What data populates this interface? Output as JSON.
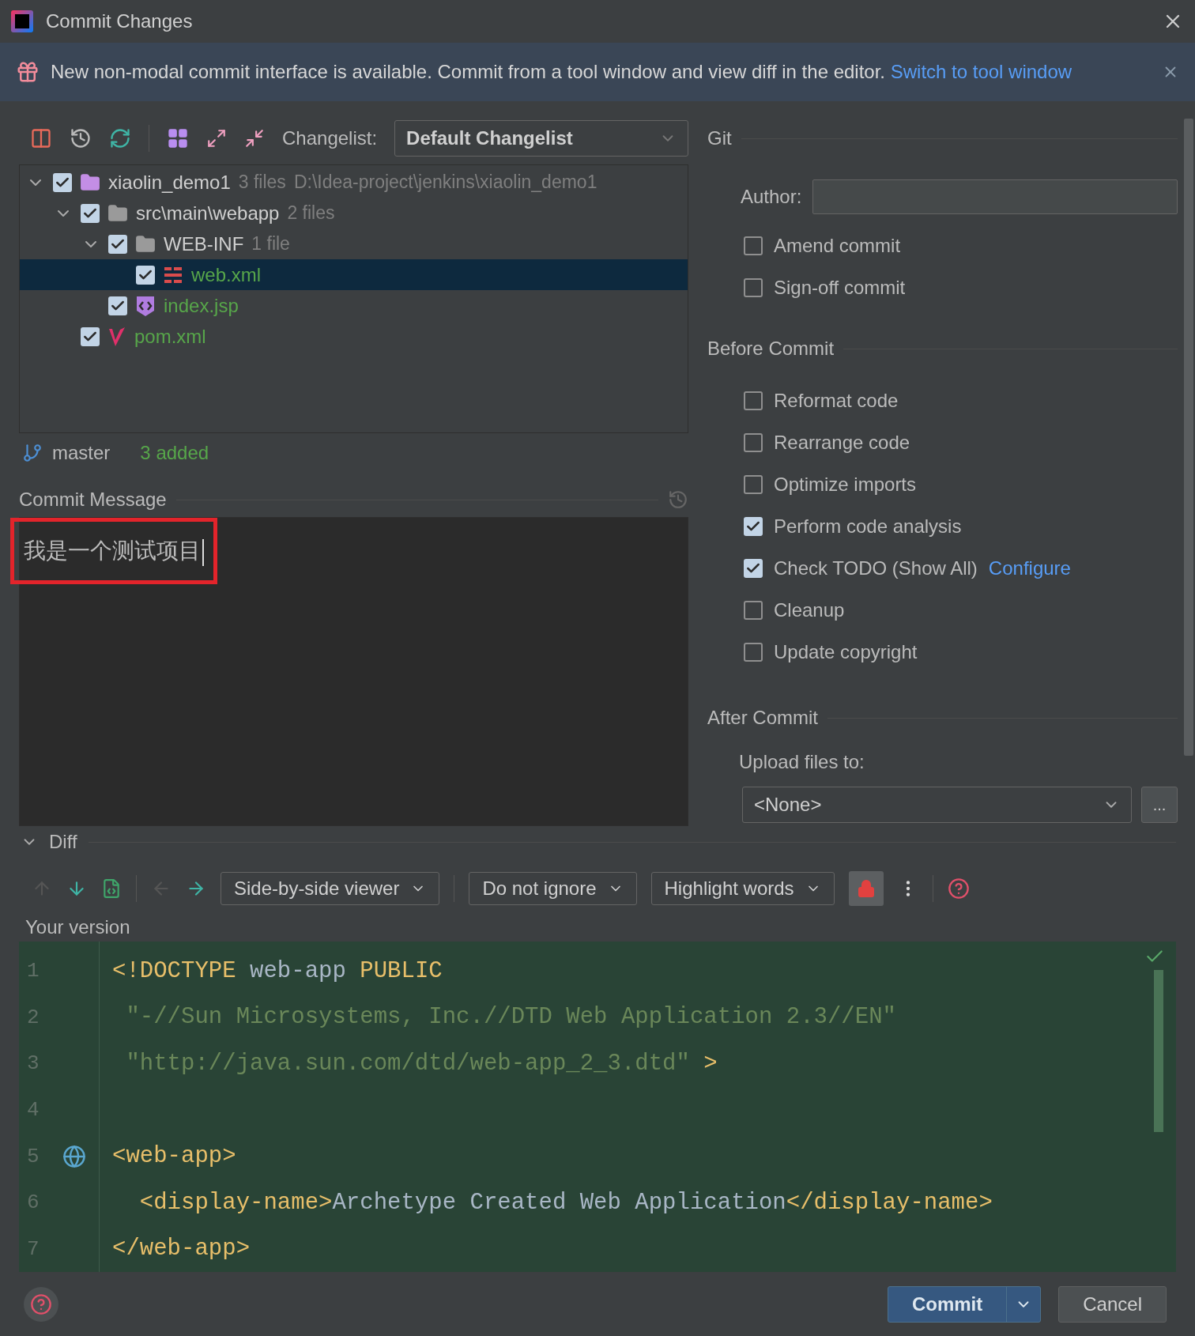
{
  "window": {
    "title": "Commit Changes"
  },
  "banner": {
    "text": "New non-modal commit interface is available. Commit from a tool window and view diff in the editor.",
    "link": "Switch to tool window"
  },
  "changes": {
    "changelist_label": "Changelist:",
    "changelist": "Default Changelist",
    "tree": [
      {
        "kind": "module",
        "name": "xiaolin_demo1",
        "count": "3 files",
        "path": "D:\\Idea-project\\jenkins\\xiaolin_demo1",
        "checked": true,
        "expanded": true,
        "selected": false,
        "added": false,
        "children": [
          {
            "kind": "folder",
            "name": "src\\main\\webapp",
            "count": "2 files",
            "checked": true,
            "expanded": true,
            "selected": false,
            "added": false,
            "children": [
              {
                "kind": "folder",
                "name": "WEB-INF",
                "count": "1 file",
                "checked": true,
                "expanded": true,
                "selected": false,
                "added": false,
                "children": [
                  {
                    "kind": "xml",
                    "name": "web.xml",
                    "checked": true,
                    "selected": true,
                    "added": true
                  }
                ]
              },
              {
                "kind": "jsp",
                "name": "index.jsp",
                "checked": true,
                "selected": false,
                "added": true
              }
            ]
          },
          {
            "kind": "maven",
            "name": "pom.xml",
            "checked": true,
            "selected": false,
            "added": true
          }
        ]
      }
    ]
  },
  "branch": {
    "name": "master",
    "summary": "3 added"
  },
  "commit_message": {
    "label": "Commit Message",
    "value": "我是一个测试项目",
    "highlighted": true
  },
  "git": {
    "title": "Git",
    "author_label": "Author:",
    "options": [
      {
        "label": "Amend commit",
        "checked": false
      },
      {
        "label": "Sign-off commit",
        "checked": false
      }
    ]
  },
  "before_commit": {
    "title": "Before Commit",
    "options": [
      {
        "label": "Reformat code",
        "checked": false
      },
      {
        "label": "Rearrange code",
        "checked": false
      },
      {
        "label": "Optimize imports",
        "checked": false
      },
      {
        "label": "Perform code analysis",
        "checked": true
      },
      {
        "label": "Check TODO (Show All)",
        "checked": true,
        "link": "Configure"
      },
      {
        "label": "Cleanup",
        "checked": false
      },
      {
        "label": "Update copyright",
        "checked": false
      }
    ]
  },
  "after_commit": {
    "title": "After Commit",
    "upload_label": "Upload files to:",
    "upload_target": "<None>",
    "browse": "..."
  },
  "diff": {
    "title": "Diff",
    "expanded": true,
    "viewer": "Side-by-side viewer",
    "ignore": "Do not ignore",
    "highlight": "Highlight words",
    "locked": true,
    "side_label": "Your version",
    "lines": [
      {
        "number": "1",
        "marker": false,
        "segments": [
          {
            "kind": "tag",
            "text": "<!DOCTYPE"
          },
          {
            "kind": "text",
            "text": " web-app "
          },
          {
            "kind": "tag",
            "text": "PUBLIC"
          }
        ]
      },
      {
        "number": "2",
        "marker": false,
        "segments": [
          {
            "kind": "string",
            "text": " \"-//Sun Microsystems, Inc.//DTD Web Application 2.3//EN\""
          }
        ]
      },
      {
        "number": "3",
        "marker": false,
        "segments": [
          {
            "kind": "string",
            "text": " \"http://java.sun.com/dtd/web-app_2_3.dtd\""
          },
          {
            "kind": "tag",
            "text": " >"
          }
        ]
      },
      {
        "number": "4",
        "marker": false
      },
      {
        "number": "5",
        "marker": true,
        "segments": [
          {
            "kind": "tag",
            "text": "<web-app>"
          }
        ]
      },
      {
        "number": "6",
        "marker": false,
        "segments": [
          {
            "kind": "tag",
            "text": "  <display-name>"
          },
          {
            "kind": "text",
            "text": "Archetype Created Web Application"
          },
          {
            "kind": "tag",
            "text": "</display-name>"
          }
        ]
      },
      {
        "number": "7",
        "marker": false,
        "segments": [
          {
            "kind": "tag",
            "text": "</web-app>"
          }
        ]
      }
    ]
  },
  "footer": {
    "commit": "Commit",
    "cancel": "Cancel"
  }
}
